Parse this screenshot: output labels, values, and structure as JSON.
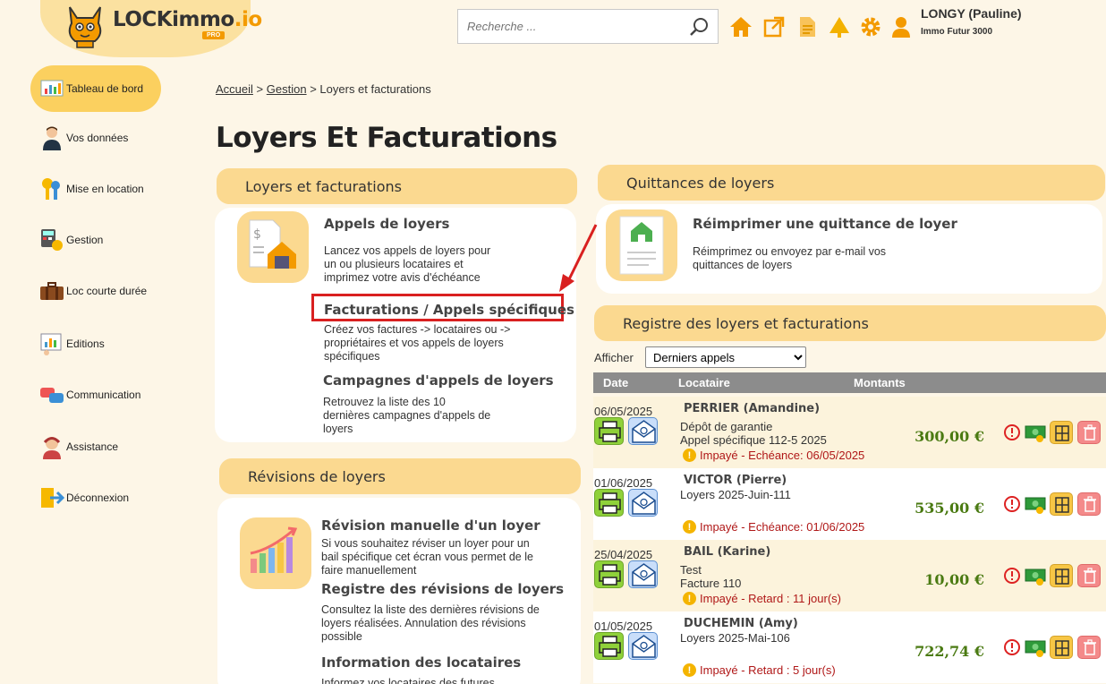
{
  "header": {
    "logo": {
      "main": "LOCKimmo",
      "suffix": ".io",
      "badge": "PRO"
    },
    "search_placeholder": "Recherche ...",
    "icons": [
      "home-icon",
      "external-link-icon",
      "document-icon",
      "tree-icon",
      "gear-icon",
      "user-icon"
    ],
    "user_name": "LONGY (Pauline)",
    "user_org": "Immo Futur 3000"
  },
  "sidebar": {
    "items": [
      {
        "label": "Tableau de bord",
        "icon": "dashboard-icon",
        "active": true
      },
      {
        "label": "Vos données",
        "icon": "person-icon",
        "active": false
      },
      {
        "label": "Mise en location",
        "icon": "keys-icon",
        "active": false
      },
      {
        "label": "Gestion",
        "icon": "calculator-icon",
        "active": false
      },
      {
        "label": "Loc courte durée",
        "icon": "suitcase-icon",
        "active": false
      },
      {
        "label": "Editions",
        "icon": "report-icon",
        "active": false
      },
      {
        "label": "Communication",
        "icon": "chat-icon",
        "active": false
      },
      {
        "label": "Assistance",
        "icon": "headset-icon",
        "active": false
      },
      {
        "label": "Déconnexion",
        "icon": "logout-icon",
        "active": false
      }
    ]
  },
  "breadcrumb": {
    "home": "Accueil",
    "sep1": ">",
    "section": "Gestion",
    "sep2": ">",
    "current": "Loyers et facturations"
  },
  "page_title": "Loyers Et Facturations",
  "loyers_panel": {
    "title": "Loyers et facturations",
    "sections": [
      {
        "title": "Appels de loyers",
        "text": "Lancez vos appels de loyers pour\nun ou plusieurs locataires et\nimprimez votre avis d'échéance"
      },
      {
        "title": "Facturations / Appels spécifiques",
        "text": "Créez vos factures -> locataires ou ->\npropriétaires et vos appels de loyers\nspécifiques"
      },
      {
        "title": "Campagnes d'appels de loyers",
        "text": "Retrouvez la liste des 10\ndernières campagnes d'appels de\nloyers"
      }
    ]
  },
  "revisions_panel": {
    "title": "Révisions de loyers",
    "sections": [
      {
        "title": "Révision manuelle d'un loyer",
        "text": "Si vous souhaitez réviser un loyer pour un\nbail spécifique cet écran vous permet de le\nfaire manuellement"
      },
      {
        "title": "Registre des révisions de loyers",
        "text": "Consultez la liste des dernières révisions de\nloyers réalisées. Annulation des révisions\npossible"
      },
      {
        "title": "Information des locataires",
        "text": "Informez vos locataires des futures"
      }
    ]
  },
  "quittances_panel": {
    "title": "Quittances de loyers",
    "section_title": "Réimprimer une quittance de loyer",
    "section_text": "Réimprimez ou envoyez par e-mail vos\nquittances de loyers"
  },
  "registre": {
    "title": "Registre des loyers et facturations",
    "filter_label": "Afficher",
    "filter_value": "Derniers appels",
    "columns": [
      "Date",
      "Locataire",
      "Montants"
    ],
    "rows": [
      {
        "date": "06/05/2025",
        "name": "PERRIER (Amandine)",
        "line1": "Dépôt de garantie",
        "line2": "Appel spécifique 112-5 2025",
        "status": "Impayé - Echéance: 06/05/2025",
        "amount": "300,00 €"
      },
      {
        "date": "01/06/2025",
        "name": "VICTOR (Pierre)",
        "line1": "",
        "line2": "Loyers 2025-Juin-111",
        "status": "Impayé - Echéance: 01/06/2025",
        "amount": "535,00 €"
      },
      {
        "date": "25/04/2025",
        "name": "BAIL (Karine)",
        "line1": "Test",
        "line2": "Facture 110",
        "status": "Impayé - Retard : 11 jour(s)",
        "amount": "10,00 €"
      },
      {
        "date": "01/05/2025",
        "name": "DUCHEMIN (Amy)",
        "line1": "",
        "line2": "Loyers 2025-Mai-106",
        "status": "Impayé - Retard : 5 jour(s)",
        "amount": "722,74 €"
      }
    ]
  },
  "colors": {
    "accent": "#fbd990",
    "active_nav": "#fbd05f",
    "amount": "#4a7a12",
    "unpaid": "#b01818",
    "highlight": "#d92020"
  }
}
